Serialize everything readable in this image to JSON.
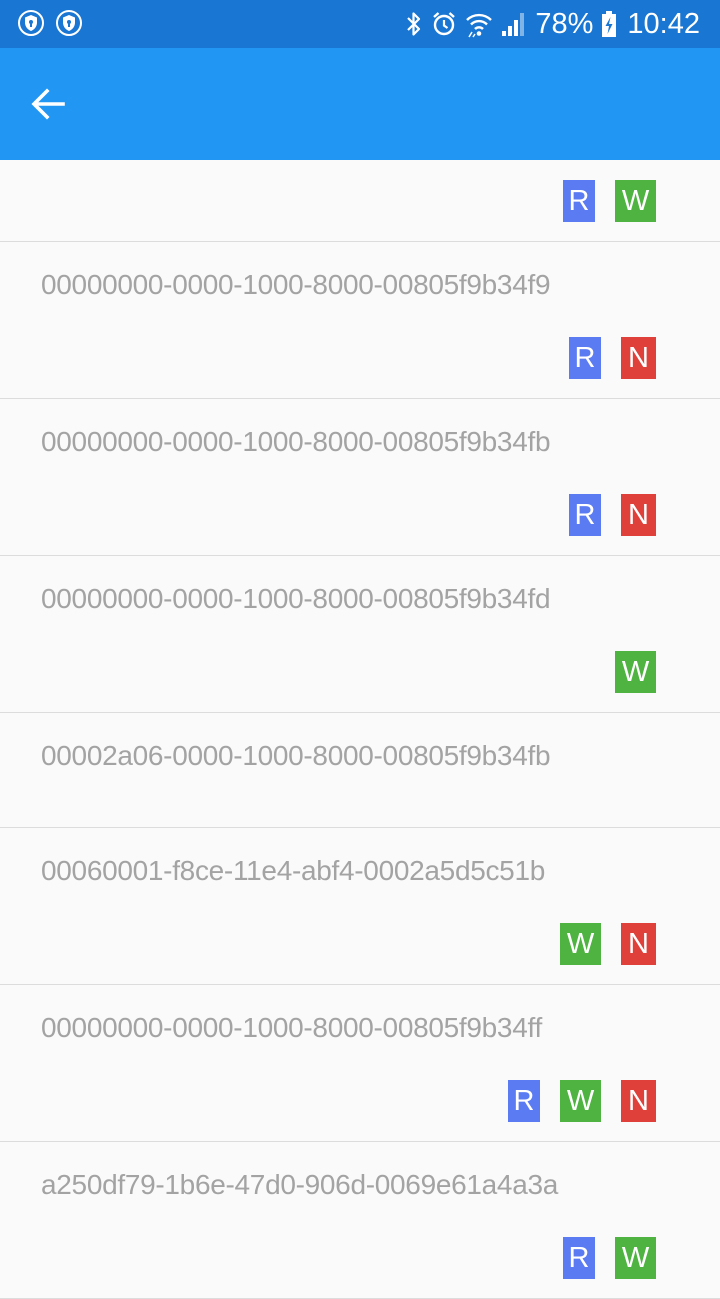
{
  "status_bar": {
    "left_icons": [
      "shield-icon",
      "shield-icon"
    ],
    "right_icons": [
      "bluetooth-icon",
      "alarm-icon",
      "wifi-icon",
      "signal-icon",
      "battery-charging-icon"
    ],
    "battery_percent": "78%",
    "time": "10:42",
    "background": "#1976d2"
  },
  "app_bar": {
    "back_icon": "arrow-back-icon",
    "background": "#2196f3"
  },
  "badge_colors": {
    "R": "#5b7bf3",
    "W": "#4eb340",
    "N": "#e0403a"
  },
  "characteristics": [
    {
      "uuid": "",
      "badges": [
        "R",
        "W"
      ]
    },
    {
      "uuid": "00000000-0000-1000-8000-00805f9b34f9",
      "badges": [
        "R",
        "N"
      ]
    },
    {
      "uuid": "00000000-0000-1000-8000-00805f9b34fb",
      "badges": [
        "R",
        "N"
      ]
    },
    {
      "uuid": "00000000-0000-1000-8000-00805f9b34fd",
      "badges": [
        "W"
      ]
    },
    {
      "uuid": "00002a06-0000-1000-8000-00805f9b34fb",
      "badges": []
    },
    {
      "uuid": "00060001-f8ce-11e4-abf4-0002a5d5c51b",
      "badges": [
        "W",
        "N"
      ]
    },
    {
      "uuid": "00000000-0000-1000-8000-00805f9b34ff",
      "badges": [
        "R",
        "W",
        "N"
      ]
    },
    {
      "uuid": "a250df79-1b6e-47d0-906d-0069e61a4a3a",
      "badges": [
        "R",
        "W"
      ]
    }
  ]
}
